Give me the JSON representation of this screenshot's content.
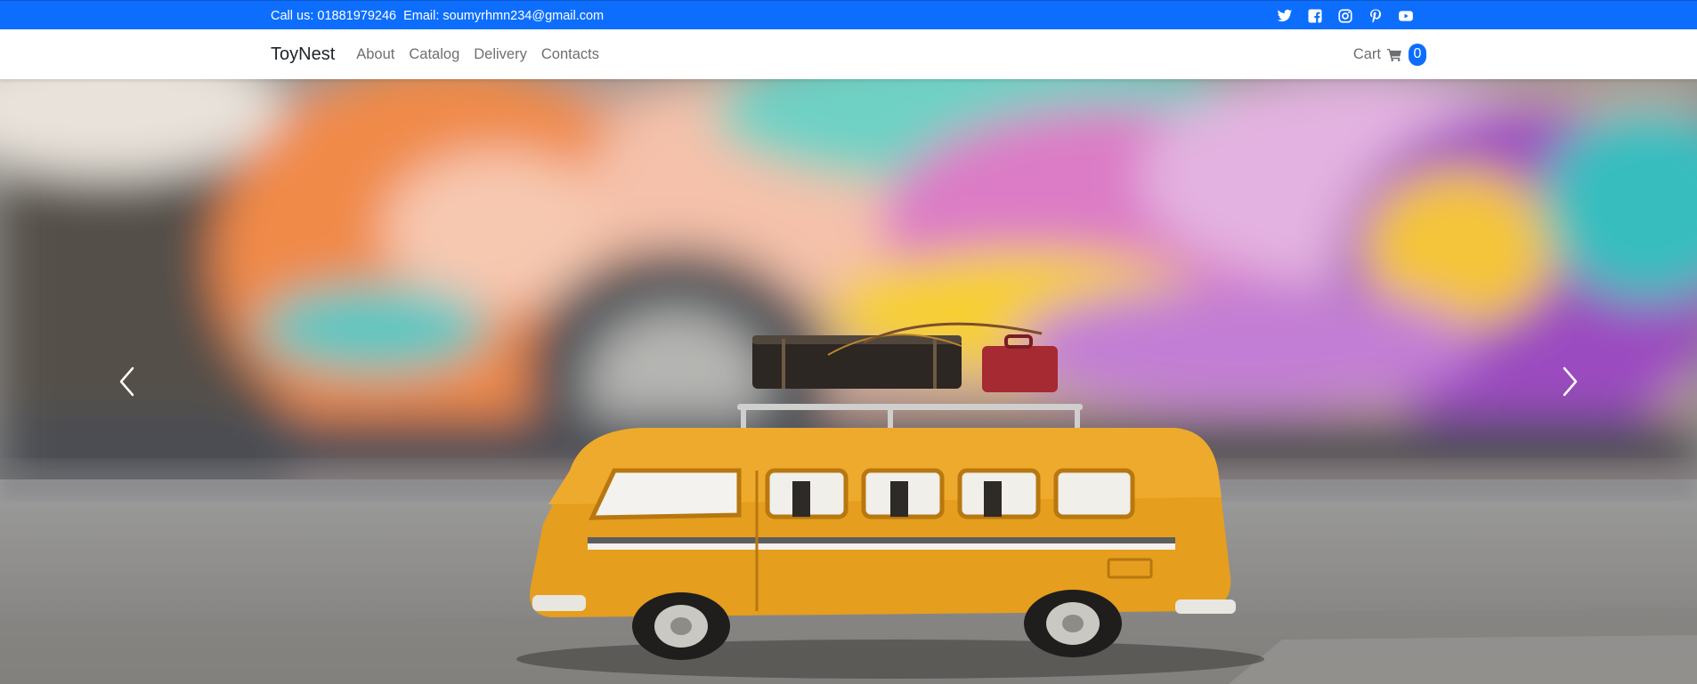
{
  "topbar": {
    "phone_text": "Call us: 01881979246",
    "email_text": "Email: soumyrhmn234@gmail.com",
    "background_color": "#0d6efd",
    "social_icons": [
      "twitter-icon",
      "facebook-square-icon",
      "instagram-icon",
      "pinterest-icon",
      "youtube-icon"
    ]
  },
  "navbar": {
    "brand": "ToyNest",
    "links": [
      "About",
      "Catalog",
      "Delivery",
      "Contacts"
    ],
    "cart_label": "Cart",
    "cart_icon": "shopping-cart-icon",
    "cart_count": "0",
    "badge_color": "#0d6efd"
  },
  "carousel": {
    "slide_image": "toy yellow bus with luggage on roof in front of blurred colorful graffiti",
    "prev_icon": "chevron-left-icon",
    "next_icon": "chevron-right-icon",
    "bus_color": "#e59e1e"
  }
}
